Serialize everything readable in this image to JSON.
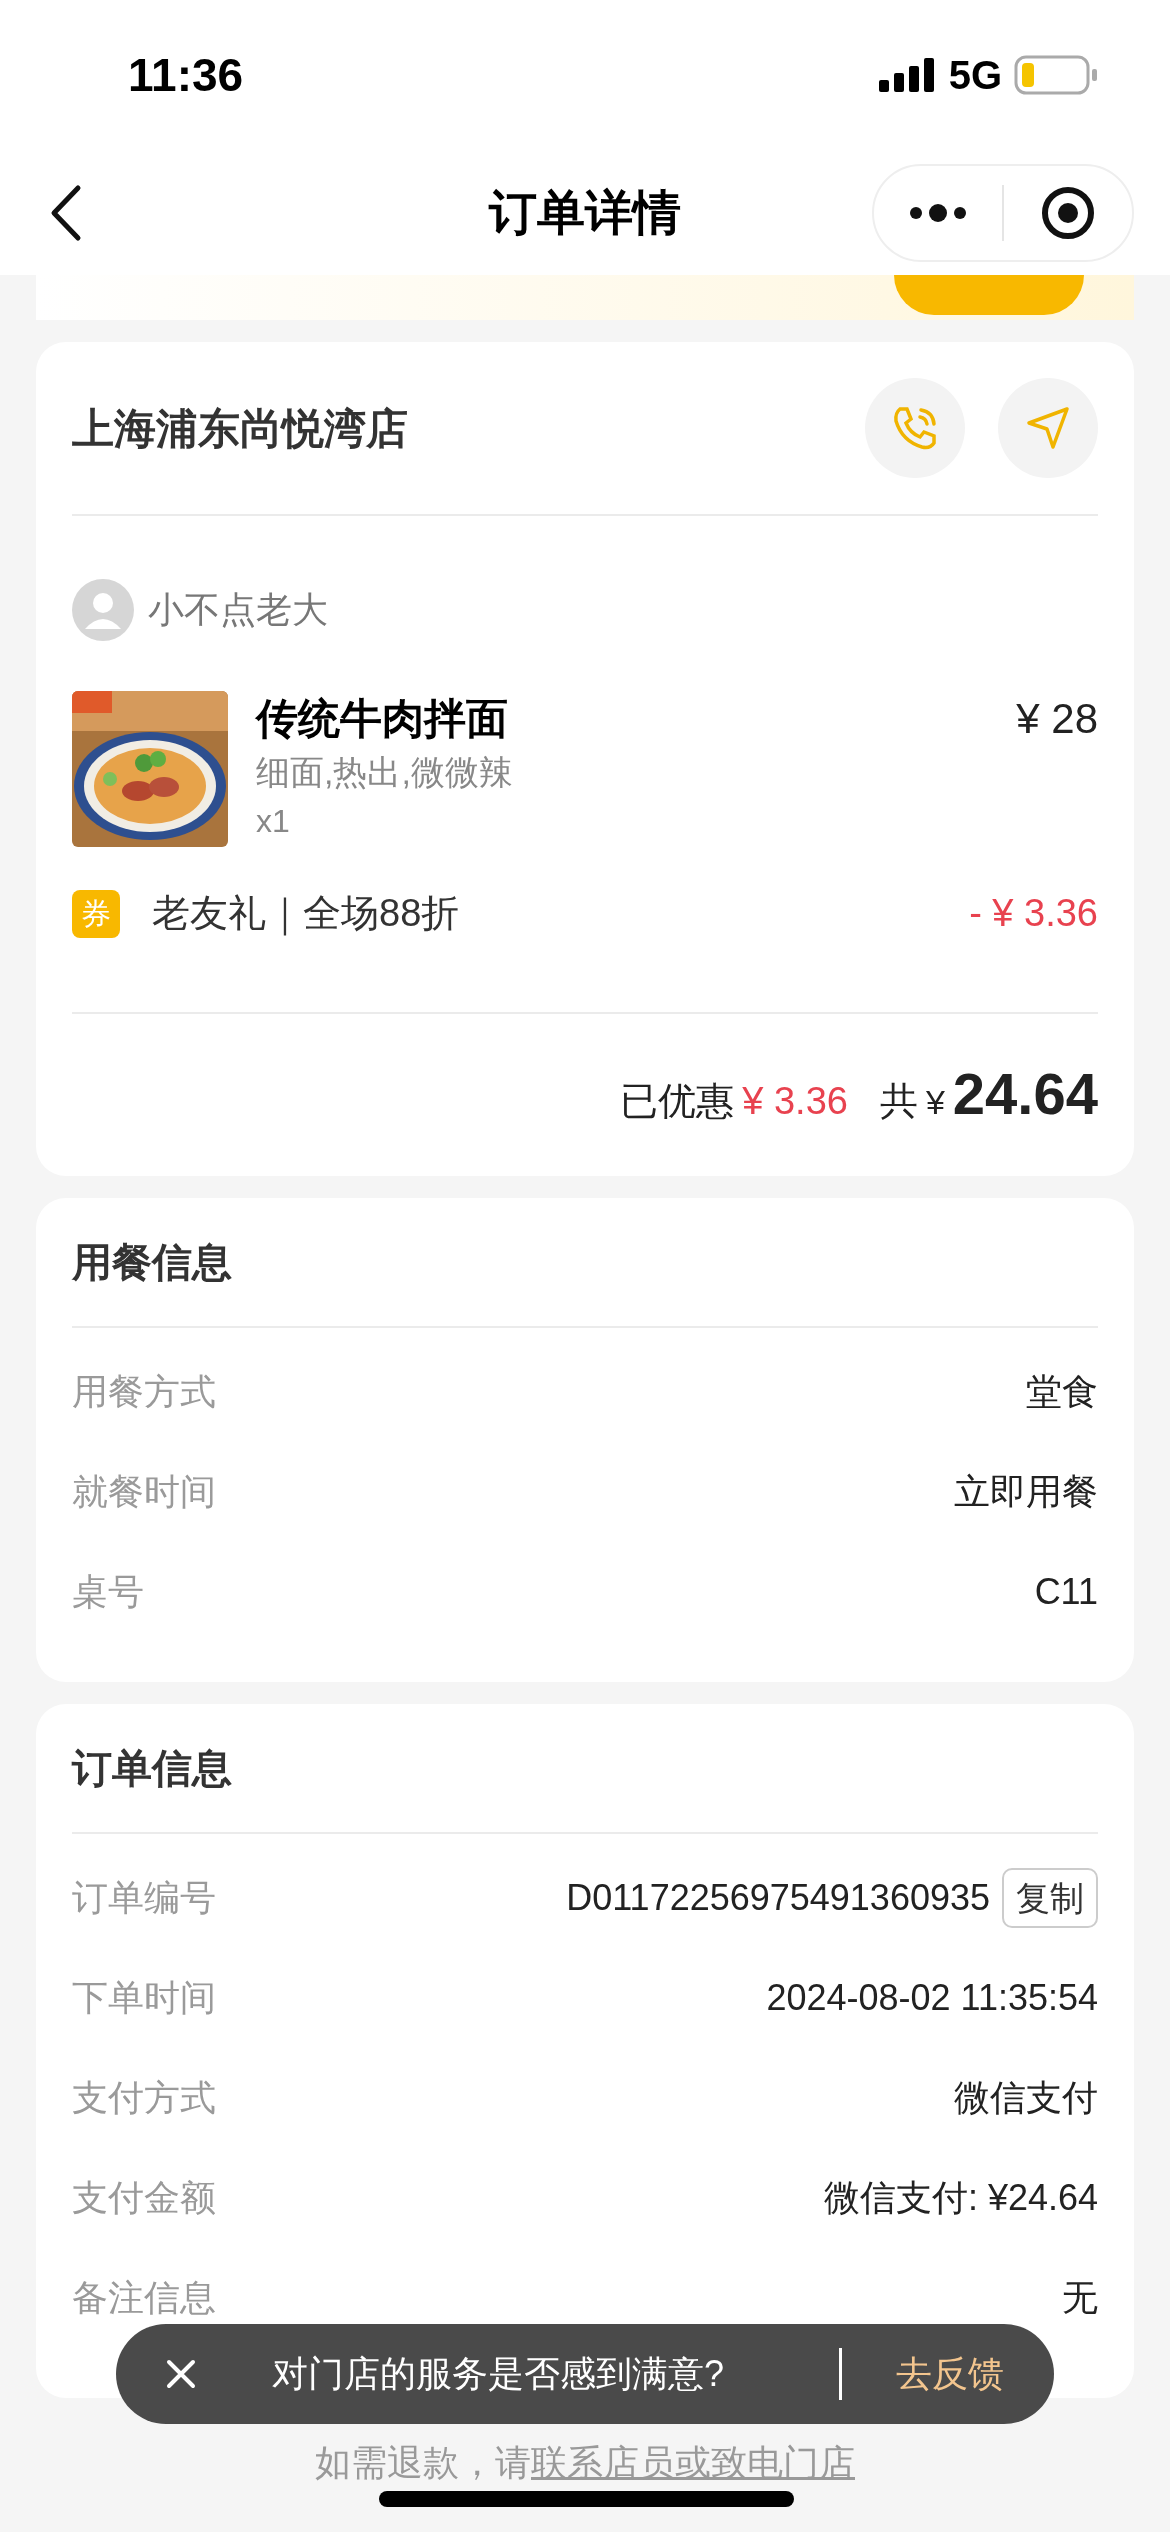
{
  "status_bar": {
    "time": "11:36",
    "network": "5G"
  },
  "nav": {
    "title": "订单详情"
  },
  "store": {
    "name": "上海浦东尚悦湾店",
    "user": "小不点老大",
    "items": [
      {
        "name": "传统牛肉拌面",
        "options": "细面,热出,微微辣",
        "quantity": "x1",
        "price": "¥ 28"
      }
    ],
    "coupon": {
      "badge": "券",
      "label": "老友礼｜全场88折",
      "amount": "- ¥ 3.36"
    },
    "discount_label": "已优惠",
    "discount": "¥ 3.36",
    "total_label": "共",
    "currency": "¥",
    "total": "24.64"
  },
  "meal_info": {
    "title": "用餐信息",
    "rows": [
      {
        "label": "用餐方式",
        "value": "堂食"
      },
      {
        "label": "就餐时间",
        "value": "立即用餐"
      },
      {
        "label": "桌号",
        "value": "C11"
      }
    ]
  },
  "order_info": {
    "title": "订单信息",
    "rows": [
      {
        "label": "订单编号",
        "value": "D01172256975491360935",
        "action": "复制"
      },
      {
        "label": "下单时间",
        "value": "2024-08-02 11:35:54"
      },
      {
        "label": "支付方式",
        "value": "微信支付"
      },
      {
        "label": "支付金额",
        "value": "微信支付: ¥24.64"
      },
      {
        "label": "备注信息",
        "value": "无"
      }
    ]
  },
  "toast": {
    "message": "对门店的服务是否感到满意?",
    "action": "去反馈"
  },
  "footer": {
    "text": "如需退款，请",
    "link": "联系店员或致电门店"
  }
}
